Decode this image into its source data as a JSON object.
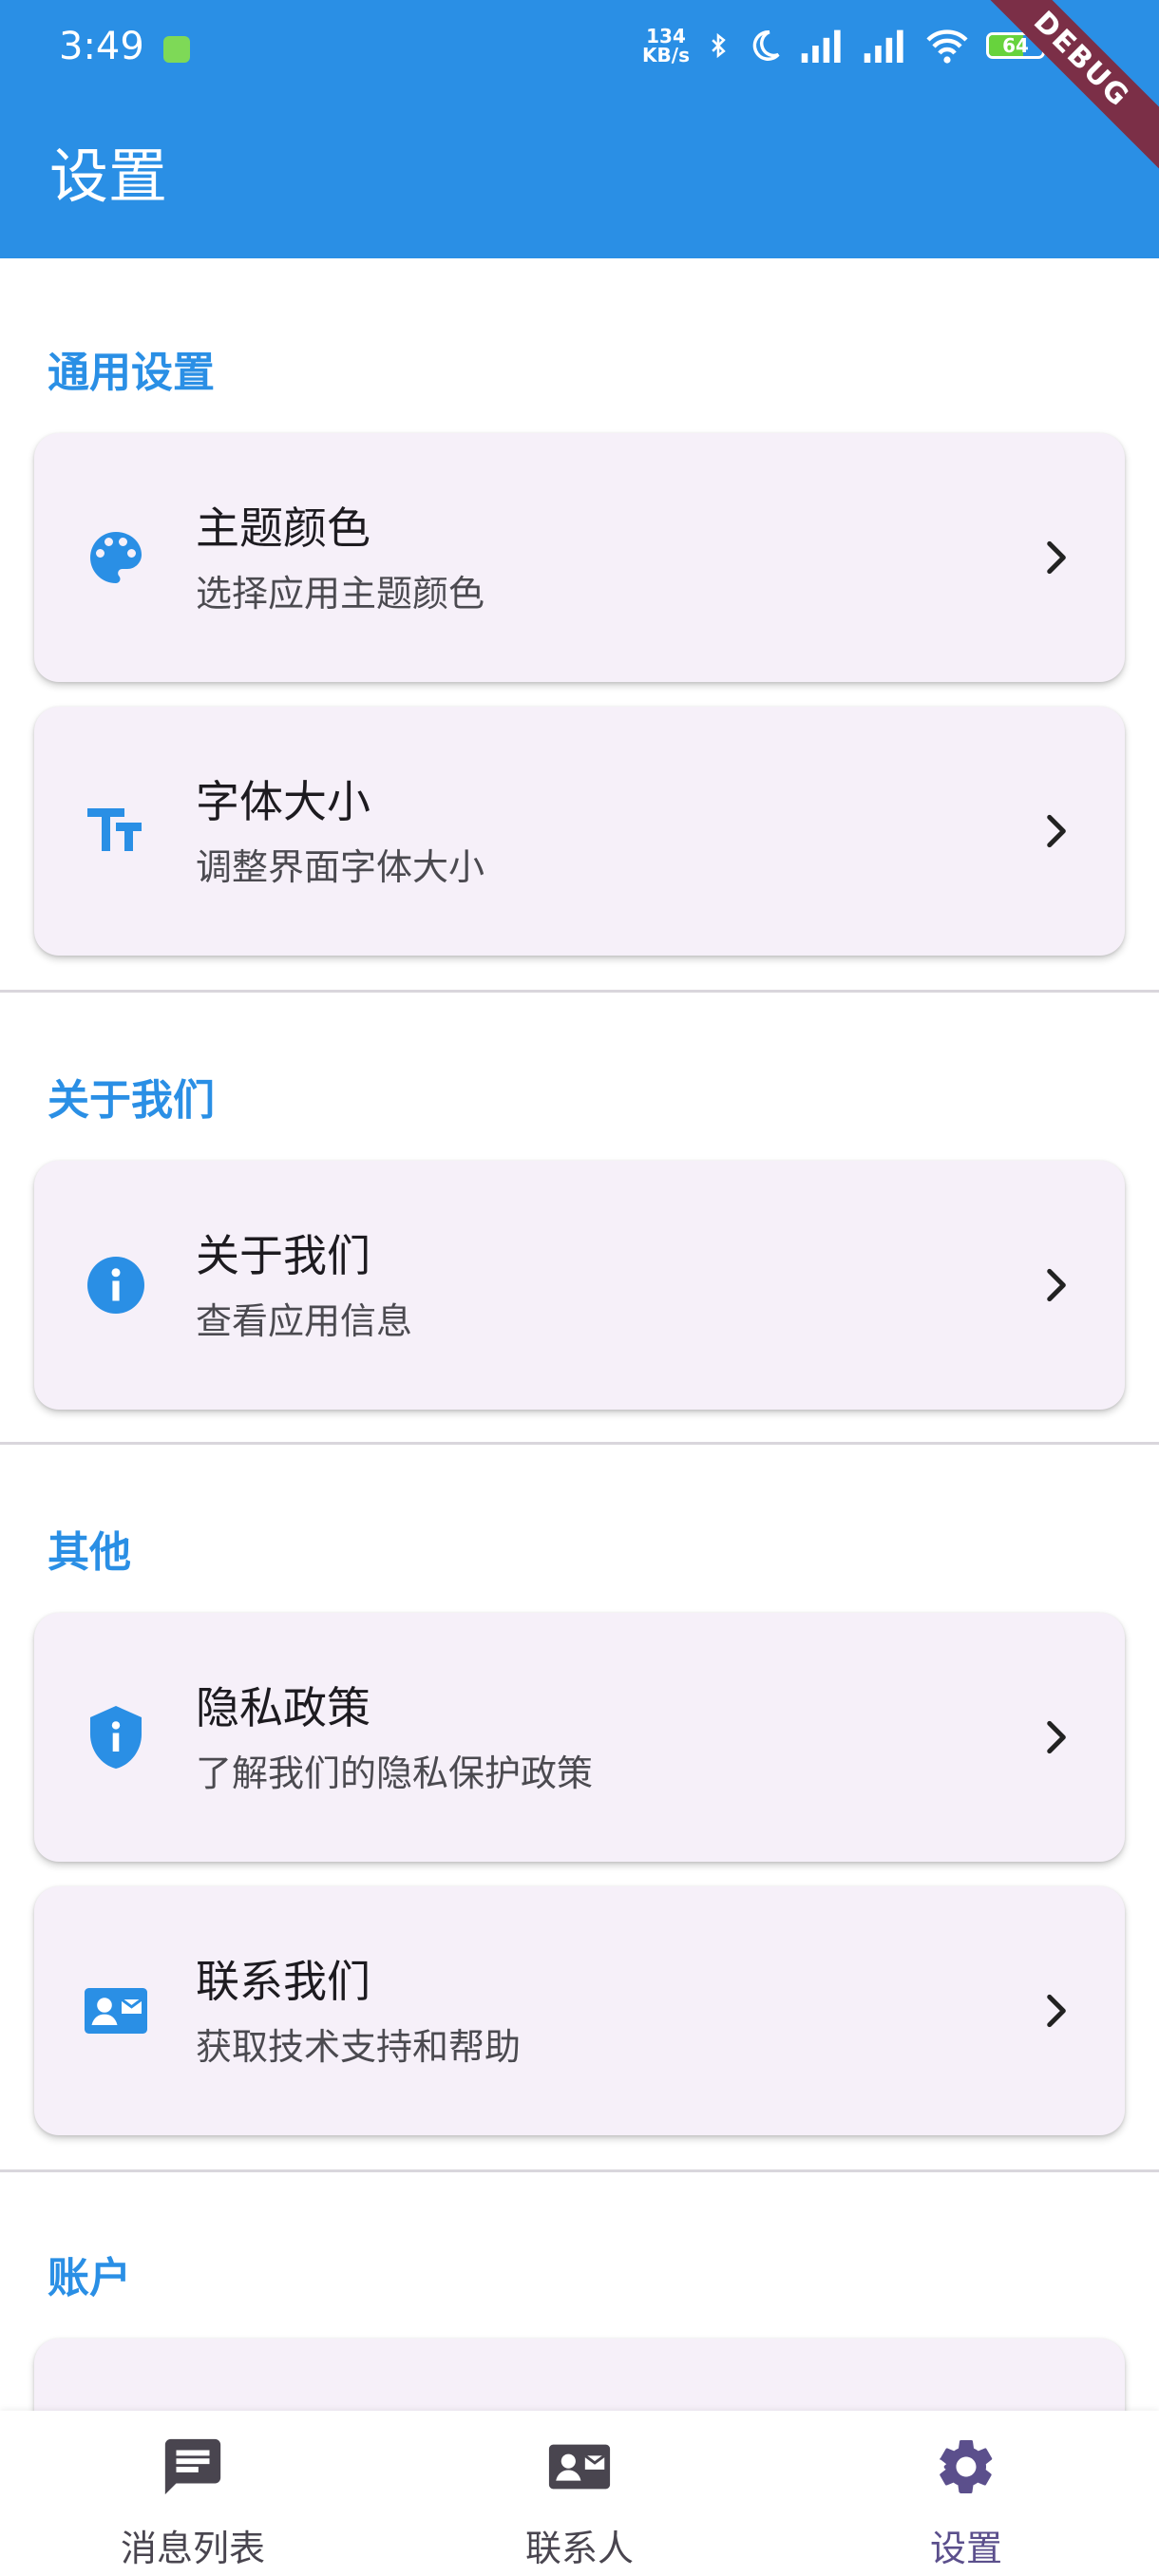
{
  "status_bar": {
    "time": "3:49",
    "net_speed_value": "134",
    "net_speed_unit": "KB/s",
    "battery": "64",
    "battery_level_percent": 64,
    "debug_badge": "DEBUG"
  },
  "appbar": {
    "title": "设置"
  },
  "sections": [
    {
      "header": "通用设置"
    },
    {
      "header": "关于我们"
    },
    {
      "header": "其他"
    },
    {
      "header": "账户"
    }
  ],
  "cards": {
    "theme": {
      "title": "主题颜色",
      "subtitle": "选择应用主题颜色",
      "icon": "palette-icon"
    },
    "font": {
      "title": "字体大小",
      "subtitle": "调整界面字体大小",
      "icon": "text-size-icon"
    },
    "about": {
      "title": "关于我们",
      "subtitle": "查看应用信息",
      "icon": "info-icon"
    },
    "privacy": {
      "title": "隐私政策",
      "subtitle": "了解我们的隐私保护政策",
      "icon": "privacy-shield-icon"
    },
    "contact": {
      "title": "联系我们",
      "subtitle": "获取技术支持和帮助",
      "icon": "contact-card-icon"
    }
  },
  "bottom_nav": [
    {
      "label": "消息列表",
      "icon": "message-icon"
    },
    {
      "label": "联系人",
      "icon": "contact-card-icon"
    },
    {
      "label": "设置",
      "icon": "gear-icon",
      "active": true
    }
  ],
  "colors": {
    "primary": "#2a8fe5",
    "card_bg": "#f6f0f9",
    "nav_active": "#5b4f8c",
    "nav_inactive": "#49454f"
  }
}
